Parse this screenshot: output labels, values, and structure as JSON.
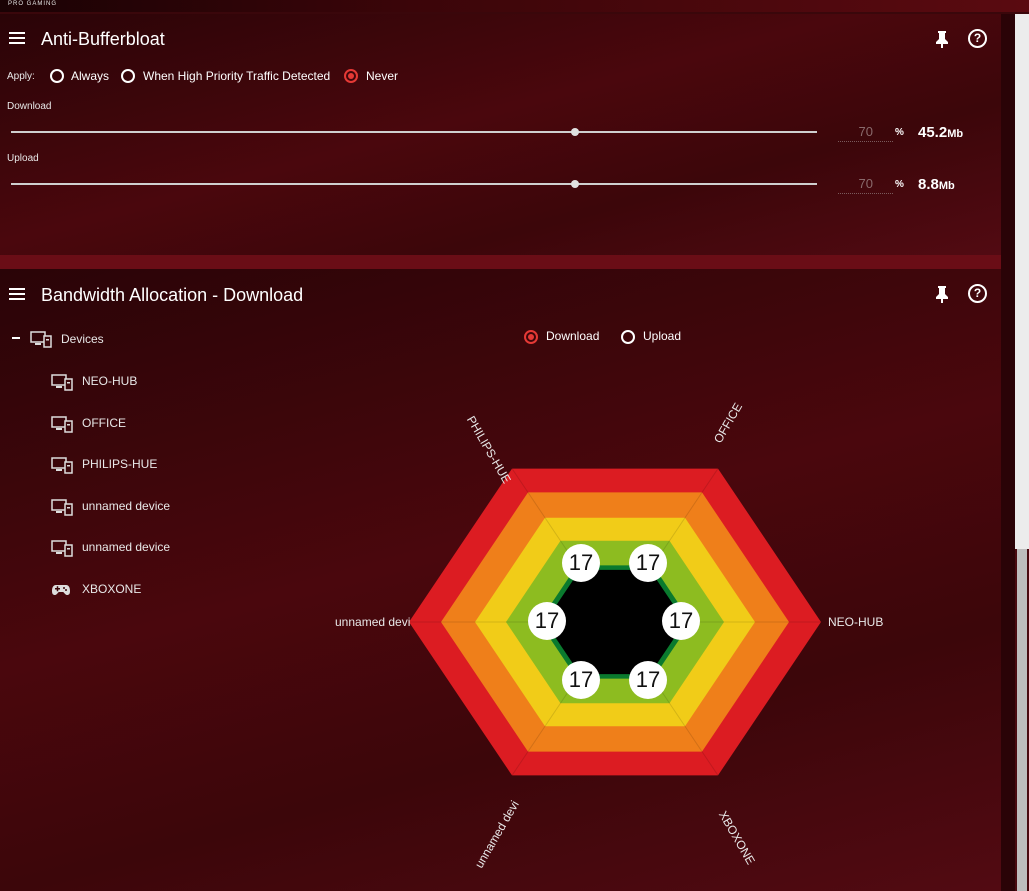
{
  "brand": "PRO GAMING",
  "anti_bufferbloat": {
    "title": "Anti-Bufferbloat",
    "apply_label": "Apply:",
    "options": [
      {
        "label": "Always",
        "checked": false
      },
      {
        "label": "When High Priority Traffic Detected",
        "checked": false
      },
      {
        "label": "Never",
        "checked": true
      }
    ],
    "download": {
      "label": "Download",
      "percent": "70",
      "pct_sign": "%",
      "value": "45.2",
      "unit": "Mb",
      "level": 0.7
    },
    "upload": {
      "label": "Upload",
      "percent": "70",
      "pct_sign": "%",
      "value": "8.8",
      "unit": "Mb",
      "level": 0.7
    }
  },
  "bandwidth": {
    "title": "Bandwidth Allocation - Download",
    "tree_root": "Devices",
    "devices": [
      {
        "name": "NEO-HUB",
        "icon": "computer-icon"
      },
      {
        "name": "OFFICE",
        "icon": "computer-icon"
      },
      {
        "name": "PHILIPS-HUE",
        "icon": "computer-icon"
      },
      {
        "name": "unnamed device",
        "icon": "computer-icon"
      },
      {
        "name": "unnamed device",
        "icon": "computer-icon"
      },
      {
        "name": "XBOXONE",
        "icon": "gamepad-icon"
      }
    ],
    "direction": [
      {
        "label": "Download",
        "checked": true
      },
      {
        "label": "Upload",
        "checked": false
      }
    ],
    "axes": {
      "top_left": "PHILIPS-HUE",
      "top_right": "OFFICE",
      "right": "NEO-HUB",
      "bottom_right": "XBOXONE",
      "bottom_left": "unnamed devi",
      "left": "unnamed devi"
    },
    "allocations": [
      "17",
      "17",
      "17",
      "17",
      "17",
      "17"
    ],
    "colors": [
      "#dc1c22",
      "#ef7f1a",
      "#f1cc18",
      "#8dbc20",
      "#0a7a2e",
      "#000000"
    ]
  }
}
